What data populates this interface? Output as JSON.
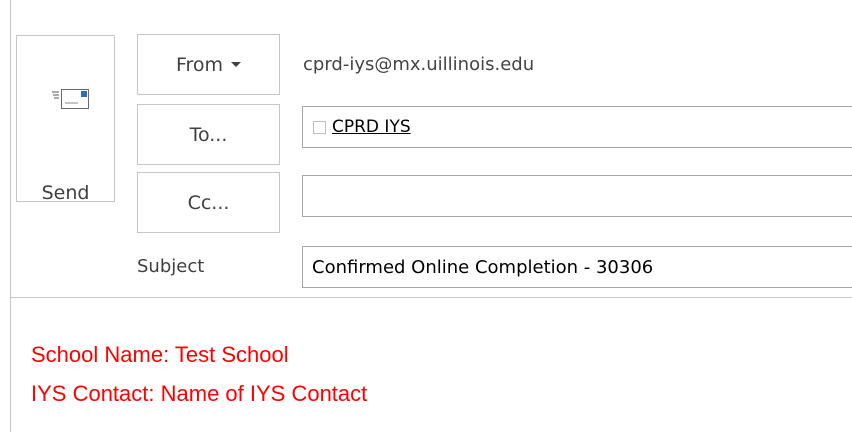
{
  "send": {
    "label": "Send",
    "icon": "envelope-send-icon"
  },
  "from": {
    "label": "From",
    "address": "cprd-iys@mx.uillinois.edu"
  },
  "to": {
    "label": "To...",
    "recipients": [
      {
        "name": "CPRD IYS"
      }
    ]
  },
  "cc": {
    "label": "Cc...",
    "value": ""
  },
  "subject": {
    "label": "Subject",
    "value": "Confirmed Online Completion - 30306"
  },
  "body": {
    "lines": [
      "School Name: Test School",
      "IYS Contact: Name of IYS Contact"
    ],
    "color": "#ff0000"
  }
}
